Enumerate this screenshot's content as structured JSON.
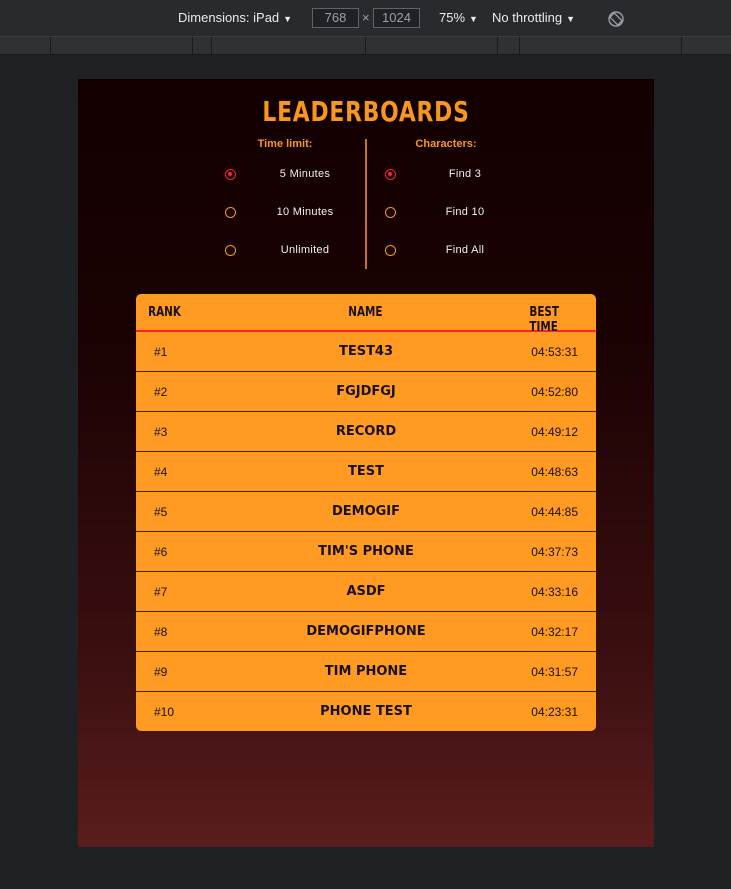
{
  "devtools": {
    "dimensions_label": "Dimensions: iPad",
    "width_value": "768",
    "height_value": "1024",
    "times": "×",
    "zoom": "75%",
    "throttling": "No throttling"
  },
  "leaderboard": {
    "title": "LEADERBOARDS",
    "time_limit": {
      "heading": "Time limit:",
      "options": [
        "5 Minutes",
        "10 Minutes",
        "Unlimited"
      ],
      "selected": 0
    },
    "characters": {
      "heading": "Characters:",
      "options": [
        "Find 3",
        "Find 10",
        "Find All"
      ],
      "selected": 0
    },
    "table": {
      "headers": {
        "rank": "RANK",
        "name": "NAME",
        "time": "BEST TIME"
      },
      "rows": [
        {
          "rank": "#1",
          "name": "TEST43",
          "time": "04:53:31"
        },
        {
          "rank": "#2",
          "name": "FGJDFGJ",
          "time": "04:52:80"
        },
        {
          "rank": "#3",
          "name": "RECORD",
          "time": "04:49:12"
        },
        {
          "rank": "#4",
          "name": "TEST",
          "time": "04:48:63"
        },
        {
          "rank": "#5",
          "name": "DEMOGIF",
          "time": "04:44:85"
        },
        {
          "rank": "#6",
          "name": "TIM'S PHONE",
          "time": "04:37:73"
        },
        {
          "rank": "#7",
          "name": "ASDF",
          "time": "04:33:16"
        },
        {
          "rank": "#8",
          "name": "DEMOGIFPHONE",
          "time": "04:32:17"
        },
        {
          "rank": "#9",
          "name": "TIM PHONE",
          "time": "04:31:57"
        },
        {
          "rank": "#10",
          "name": "PHONE TEST",
          "time": "04:23:31"
        }
      ]
    }
  },
  "colors": {
    "accent": "#f7971e",
    "table_bg": "#ff9a22",
    "selected_radio": "#ff1f3d"
  }
}
